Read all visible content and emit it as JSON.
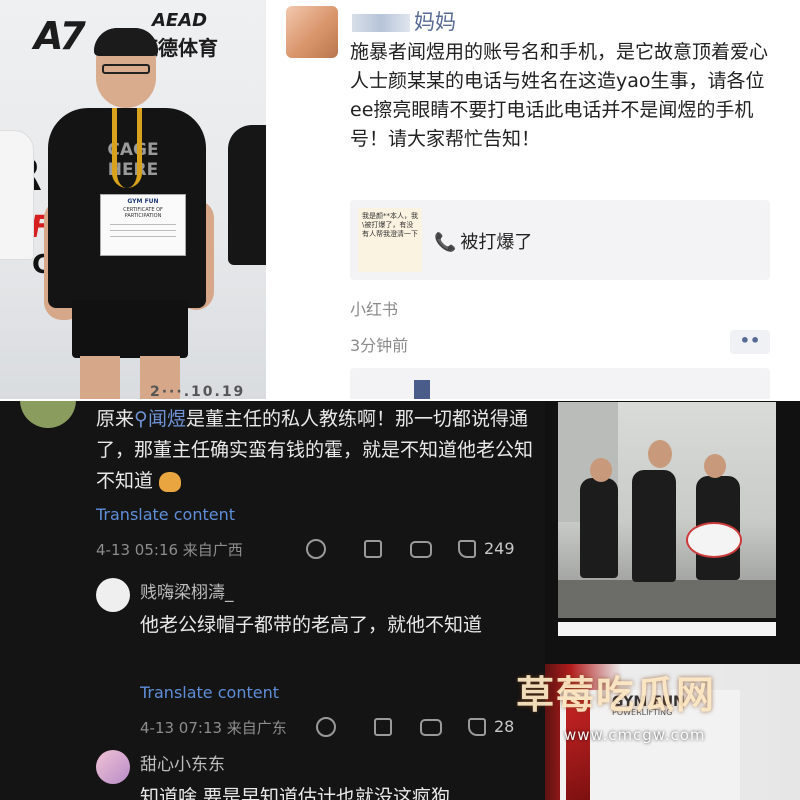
{
  "top_left_photo": {
    "logo_text": "康德体育",
    "logo_sub": "AEAD",
    "shirt_text": "CAGE\nHERE",
    "certificate_title": "GYM FUN",
    "certificate_subtitle": "CERTIFICATE OF PARTICIPATION",
    "bg_text_1": "R",
    "bg_text_2": "LIFTI",
    "bg_text_3": "CH",
    "date_text": "2···.10.19"
  },
  "wechat_post": {
    "author_suffix": "妈妈",
    "body": "施暴者闻煜用的账号名和手机，是它故意顶着爱心人士颜某某的电话与姓名在这造yao生事，请各位ee擦亮眼睛不要打电话此电话并不是闻煜的手机号！请大家帮忙告知！",
    "share_card": {
      "thumb_text": "我是颜**本人，我\\被打爆了，有没有人帮我澄清一下",
      "phone_icon": "phone-icon",
      "title": "被打爆了"
    },
    "source": "小红书",
    "time": "3分钟前",
    "more_label": "••"
  },
  "comments": [
    {
      "text_before": "原来",
      "search_term": "闻煜",
      "text_after": "是董主任的私人教练啊！那一切都说得通了，那董主任确实蛮有钱的霍，就是不知道他老公知不知道",
      "translate": "Translate content",
      "meta": "4-13 05:16  来自广西",
      "likes": "249"
    },
    {
      "author": "贱嗨梁栩濤_",
      "text": "他老公绿帽子都带的老高了，就他不知道",
      "translate": "Translate content",
      "meta": "4-13 07:13  来自广东",
      "likes": "28"
    },
    {
      "author": "甜心小东东",
      "text": "知道啥 要是早知道估计也就没这疯狗"
    }
  ],
  "right_photos": {
    "board_logo": "GYM FUN",
    "board_logo_sub": "POWERLIFTING"
  },
  "watermark": {
    "title": "草莓吃瓜网",
    "url": "www.cmcgw.com"
  }
}
